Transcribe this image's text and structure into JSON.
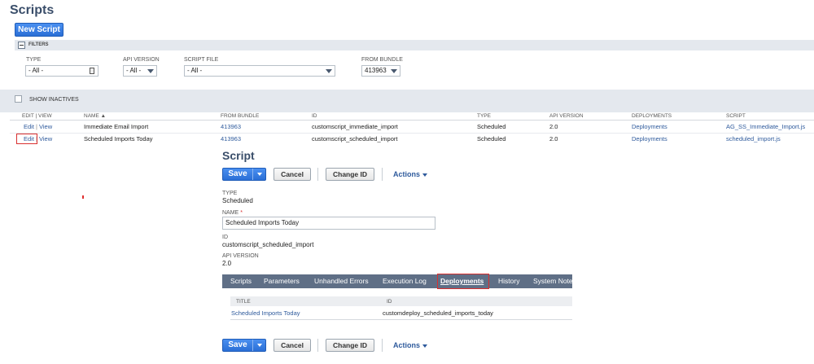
{
  "page": {
    "title": "Scripts",
    "new_script_label": "New Script",
    "filters_label": "FILTERS",
    "filters": {
      "type": {
        "label": "TYPE",
        "value": "- All -"
      },
      "api_version": {
        "label": "API VERSION",
        "value": "- All -"
      },
      "script_file": {
        "label": "SCRIPT FILE",
        "value": "- All -"
      },
      "from_bundle": {
        "label": "FROM BUNDLE",
        "value": "413963"
      }
    },
    "show_inactives_label": "SHOW INACTIVES"
  },
  "table": {
    "headers": {
      "edit_view": "EDIT | VIEW",
      "name": "NAME ▲",
      "from_bundle": "FROM BUNDLE",
      "id": "ID",
      "type": "TYPE",
      "api_version": "API VERSION",
      "deployments": "DEPLOYMENTS",
      "script": "SCRIPT"
    },
    "rows": [
      {
        "edit": "Edit",
        "sep": "|",
        "view": "View",
        "name": "Immediate Email Import",
        "from_bundle": "413963",
        "id": "customscript_immediate_import",
        "type": "Scheduled",
        "api_version": "2.0",
        "deployments": "Deployments",
        "script": "AG_SS_Immediate_Import.js"
      },
      {
        "edit": "Edit",
        "sep": "|",
        "view": "View",
        "name": "Scheduled Imports Today",
        "from_bundle": "413963",
        "id": "customscript_scheduled_import",
        "type": "Scheduled",
        "api_version": "2.0",
        "deployments": "Deployments",
        "script": "scheduled_import.js"
      }
    ]
  },
  "form": {
    "title": "Script",
    "save_label": "Save",
    "cancel_label": "Cancel",
    "change_id_label": "Change ID",
    "actions_label": "Actions",
    "type_label": "TYPE",
    "type_value": "Scheduled",
    "name_label": "NAME",
    "name_required": "*",
    "name_value": "Scheduled Imports Today",
    "id_label": "ID",
    "id_value": "customscript_scheduled_import",
    "api_label": "API VERSION",
    "api_value": "2.0",
    "tabs": [
      {
        "label": "Scripts"
      },
      {
        "label": "Parameters"
      },
      {
        "label": "Unhandled Errors"
      },
      {
        "label": "Execution Log"
      },
      {
        "label": "Deployments"
      },
      {
        "label": "History"
      },
      {
        "label": "System Notes"
      }
    ],
    "deployments": {
      "headers": {
        "title": "TITLE",
        "id": "ID"
      },
      "row": {
        "title": "Scheduled Imports Today",
        "id": "customdeploy_scheduled_imports_today"
      }
    }
  },
  "colors": {
    "accent": "#2a6fd6",
    "highlight": "#d93030",
    "tab_bar": "#5f6f86",
    "link": "#2e5a9c"
  }
}
